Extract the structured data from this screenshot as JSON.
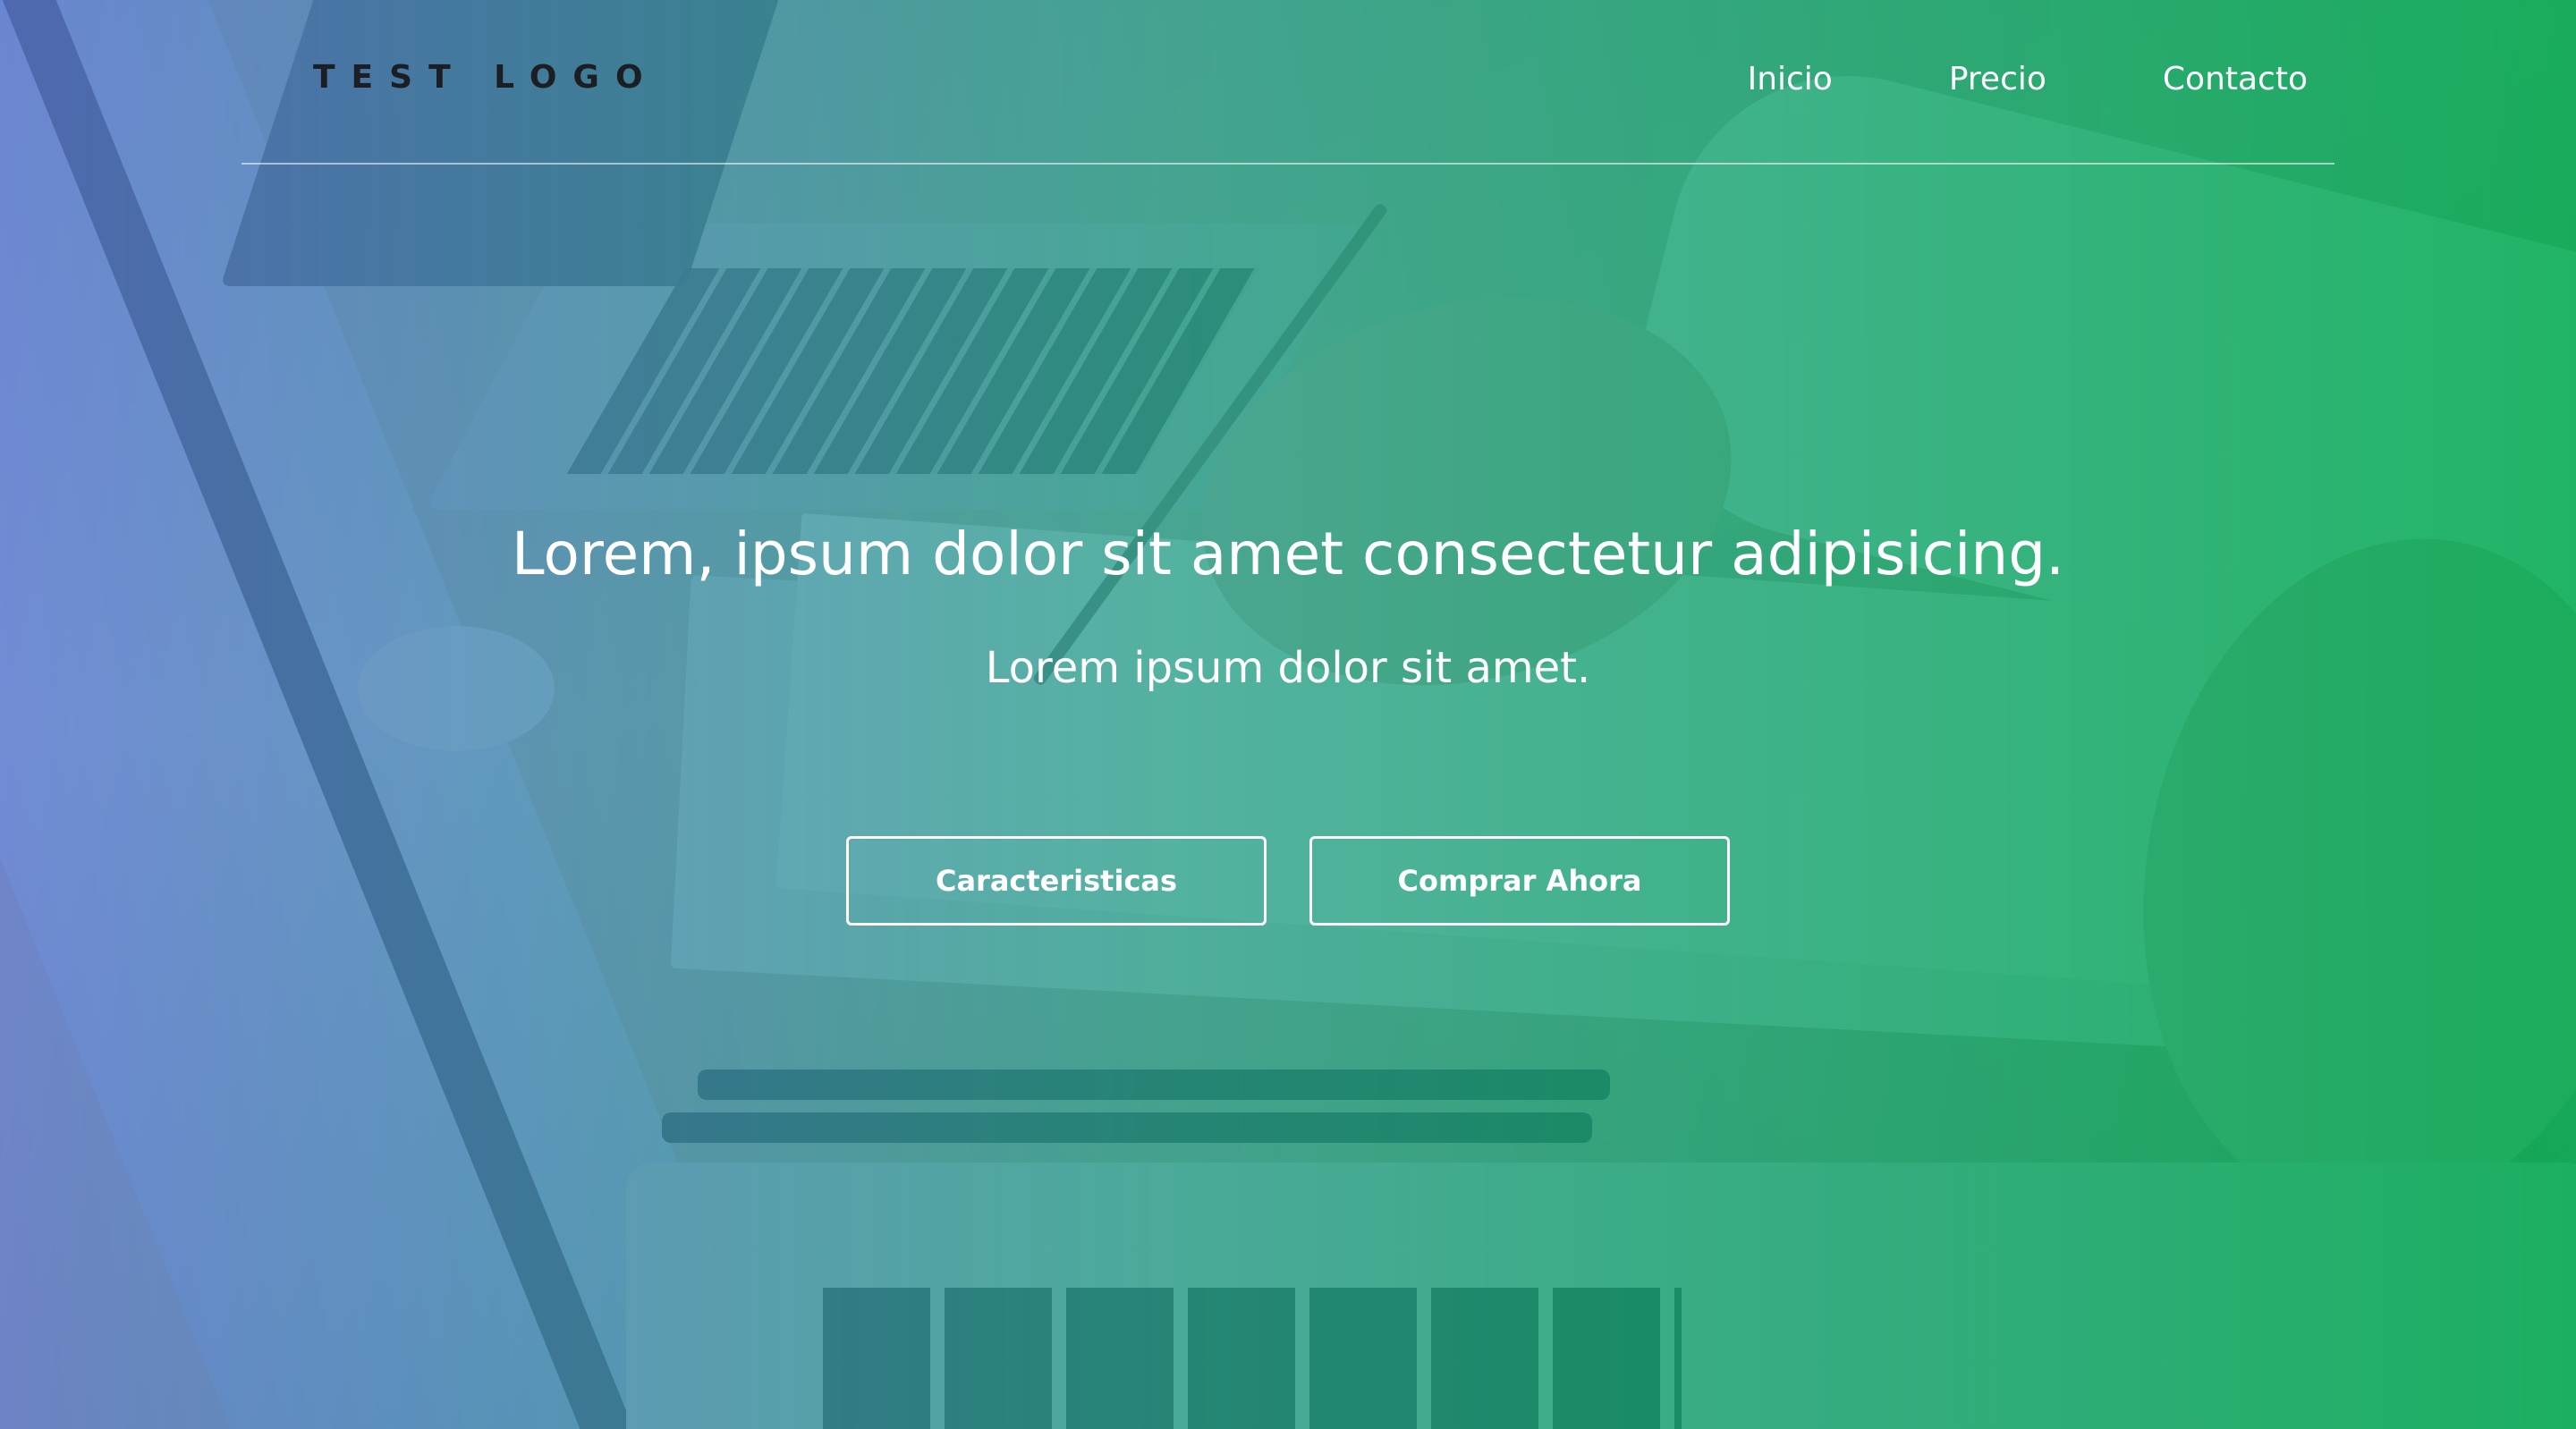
{
  "header": {
    "logo_text": "TEST LOGO",
    "nav": [
      {
        "label": "Inicio"
      },
      {
        "label": "Precio"
      },
      {
        "label": "Contacto"
      }
    ]
  },
  "hero": {
    "title": "Lorem, ipsum dolor sit amet consectetur adipisicing.",
    "subtitle": "Lorem ipsum dolor sit amet.",
    "buttons": [
      {
        "label": "Caracteristicas"
      },
      {
        "label": "Comprar Ahora"
      }
    ]
  },
  "colors": {
    "overlay_start": "#5a78d2",
    "overlay_end": "#00aa50",
    "logo": "#1b1f23",
    "text": "#ffffff"
  }
}
